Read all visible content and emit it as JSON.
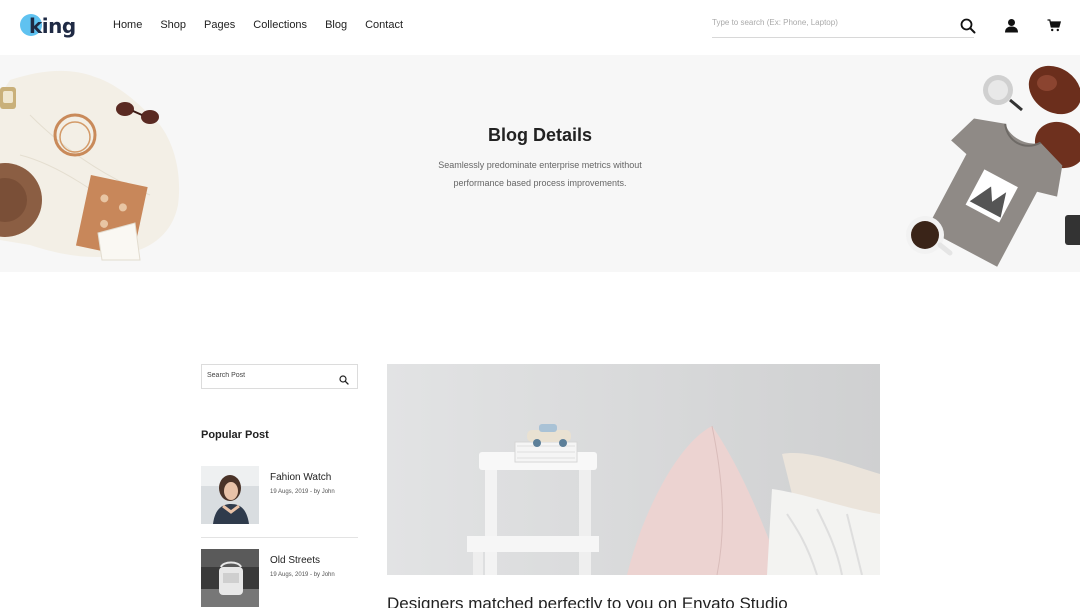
{
  "header": {
    "logo_text": "king",
    "nav": [
      "Home",
      "Shop",
      "Pages",
      "Collections",
      "Blog",
      "Contact"
    ],
    "search_placeholder": "Type to search (Ex: Phone, Laptop)",
    "icons": [
      "search-icon",
      "user-icon",
      "cart-icon"
    ]
  },
  "hero": {
    "title": "Blog Details",
    "subtitle_line1": "Seamlessly predominate enterprise metrics without",
    "subtitle_line2": "performance based process improvements."
  },
  "sidebar": {
    "search_placeholder": "Search Post",
    "popular_title": "Popular Post",
    "posts": [
      {
        "title": "Fahion Watch",
        "meta": "19 Augs, 2019 - by John"
      },
      {
        "title": "Old Streets",
        "meta": "19 Augs, 2019 - by John"
      }
    ]
  },
  "article": {
    "heading": "Designers matched perfectly to you on Envato Studio"
  },
  "colors": {
    "accent": "#5fc2f0",
    "logo_dark": "#1f2a44",
    "hero_bg": "#f7f7f7"
  }
}
